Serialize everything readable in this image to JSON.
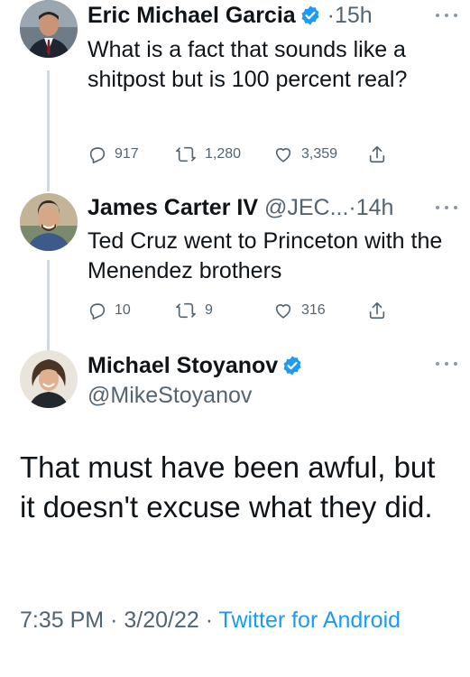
{
  "tweets": [
    {
      "name": "Eric Michael Garcia",
      "verified": true,
      "separator": "·",
      "time": "15h",
      "text": "What is a fact that sounds like a shitpost but is 100 percent real?",
      "replies": "917",
      "retweets": "1,280",
      "likes": "3,359"
    },
    {
      "name": "James Carter IV",
      "handle": "@JEC...",
      "separator": "·",
      "time": "14h",
      "text": "Ted Cruz went to Princeton with the Menendez brothers",
      "replies": "10",
      "retweets": "9",
      "likes": "316"
    }
  ],
  "main_tweet": {
    "name": "Michael Stoyanov",
    "verified": true,
    "handle": "@MikeStoyanov",
    "text": "That must have been awful, but it doesn't excuse what they did.",
    "time": "7:35 PM",
    "separator": "·",
    "date": "3/20/22",
    "separator2": "·",
    "source": "Twitter for Android"
  },
  "colors": {
    "verified": "#1d9bf0",
    "link": "#1d9bf0",
    "muted": "#536471",
    "thread_line": "#cfd9de"
  }
}
